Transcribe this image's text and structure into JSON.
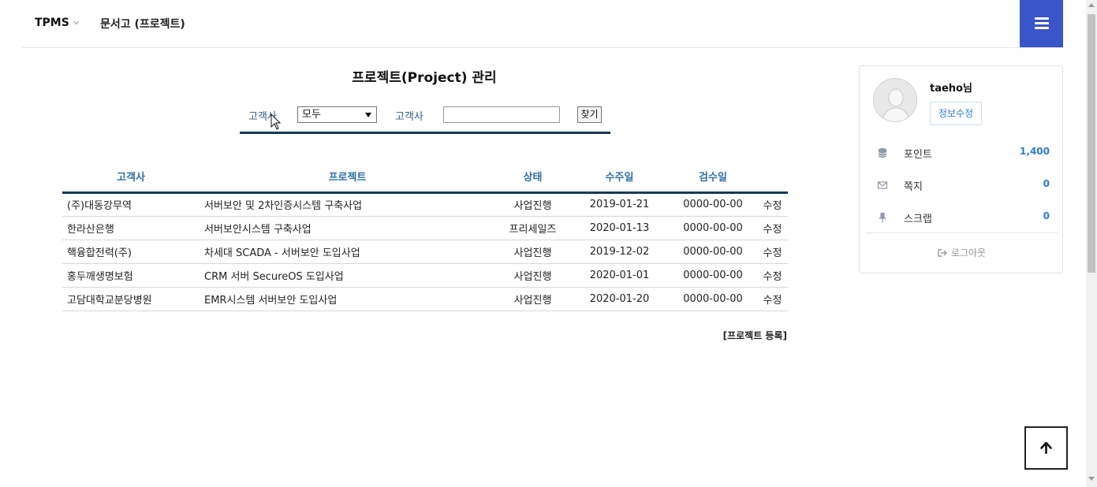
{
  "header": {
    "brand": "TPMS",
    "breadcrumb": "문서고 (프로젝트)"
  },
  "page": {
    "title": "프로젝트(Project) 관리"
  },
  "search": {
    "label_select": "고객사",
    "select_value": "모두",
    "label_input": "고객사",
    "input_value": "",
    "button_label": "찾기"
  },
  "table": {
    "headers": [
      "고객사",
      "프로젝트",
      "상태",
      "수주일",
      "검수일",
      ""
    ],
    "rows": [
      {
        "client": "(주)대동강무역",
        "project": "서버보안 및 2차인증시스템 구축사업",
        "status": "사업진행",
        "order_date": "2019-01-21",
        "inspect_date": "0000-00-00",
        "action": "수정"
      },
      {
        "client": "한라산은행",
        "project": "서버보안시스템 구축사업",
        "status": "프리세일즈",
        "order_date": "2020-01-13",
        "inspect_date": "0000-00-00",
        "action": "수정"
      },
      {
        "client": "핵융합전력(주)",
        "project": "차세대 SCADA - 서버보안 도입사업",
        "status": "사업진행",
        "order_date": "2019-12-02",
        "inspect_date": "0000-00-00",
        "action": "수정"
      },
      {
        "client": "홍두깨생명보험",
        "project": "CRM 서버 SecureOS 도입사업",
        "status": "사업진행",
        "order_date": "2020-01-01",
        "inspect_date": "0000-00-00",
        "action": "수정"
      },
      {
        "client": "고담대학교분당병원",
        "project": "EMR시스템 서버보안 도입사업",
        "status": "사업진행",
        "order_date": "2020-01-20",
        "inspect_date": "0000-00-00",
        "action": "수정"
      }
    ]
  },
  "register_link": "[프로젝트 등록]",
  "profile": {
    "username": "taeho님",
    "edit_label": "정보수정",
    "stats": [
      {
        "icon": "database-icon",
        "label": "포인트",
        "value": "1,400"
      },
      {
        "icon": "envelope-icon",
        "label": "쪽지",
        "value": "0"
      },
      {
        "icon": "pin-icon",
        "label": "스크랩",
        "value": "0"
      }
    ],
    "logout_label": "로그아웃"
  },
  "colors": {
    "accent": "#3a54c9",
    "link": "#2f7ad1",
    "header_text": "#2f6fa8",
    "rule": "#17385a"
  }
}
